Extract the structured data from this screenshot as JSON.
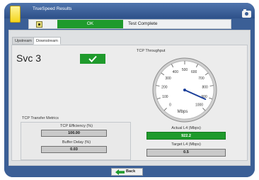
{
  "app": {
    "title": "TrueSpeed Results",
    "icon": "app-icon",
    "camera_icon": "camera-icon"
  },
  "status": {
    "icon": "status-icon",
    "state": "OK",
    "message": "Test Complete"
  },
  "tabs": [
    {
      "label": "Upstream",
      "selected": false
    },
    {
      "label": "Downstream",
      "selected": true
    }
  ],
  "service": {
    "label": "Svc 3",
    "result_icon": "checkmark-icon"
  },
  "metrics": {
    "title": "TCP Transfer Metrics",
    "efficiency": {
      "label": "TCP Efficiency (%)",
      "value": "100.00"
    },
    "buffer_delay": {
      "label": "Buffer Delay (%)",
      "value": "0.03"
    }
  },
  "throughput": {
    "title": "TCP Throughput",
    "gauge": {
      "ticks": [
        "0",
        "100",
        "200",
        "300",
        "400",
        "500",
        "600",
        "700",
        "800",
        "900",
        "1000"
      ],
      "min": 0,
      "max": 1000,
      "unit": "Mbps",
      "needle_value": 922.2
    },
    "actual": {
      "label": "Actual L4 (Mbps)",
      "value": "922.2"
    },
    "target": {
      "label": "Target L4 (Mbps)",
      "value": "0.5"
    }
  },
  "footer": {
    "back_label": "Back",
    "back_icon": "arrow-left-icon"
  },
  "colors": {
    "frame": "#3b5f96",
    "ok_green": "#1f9a2c",
    "needle": "#1b3f9a"
  }
}
